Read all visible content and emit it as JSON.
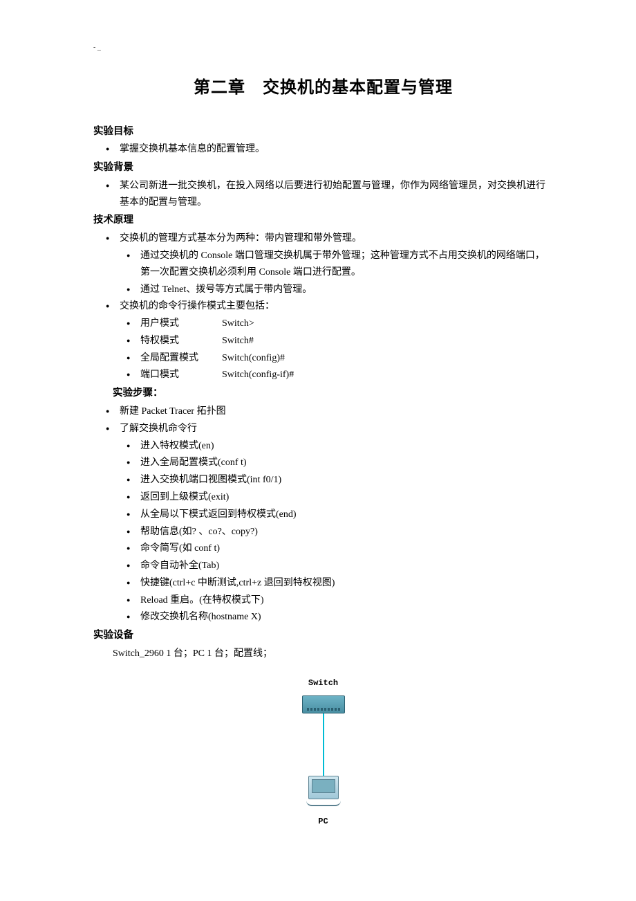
{
  "mark": "- _",
  "title": "第二章　交换机的基本配置与管理",
  "sections": {
    "goal_h": "实验目标",
    "goal_item": "掌握交换机基本信息的配置管理。",
    "bg_h": "实验背景",
    "bg_item": "某公司新进一批交换机，在投入网络以后要进行初始配置与管理，你作为网络管理员，对交换机进行基本的配置与管理。",
    "tech_h": "技术原理",
    "tech_sw_mgmt": "交换机的管理方式基本分为两种：带内管理和带外管理。",
    "tech_console": "通过交换机的 Console 端口管理交换机属于带外管理；这种管理方式不占用交换机的网络端口，第一次配置交换机必须利用 Console 端口进行配置。",
    "tech_telnet": "通过 Telnet、拨号等方式属于带内管理。",
    "tech_modes_h": "交换机的命令行操作模式主要包括：",
    "modes": [
      {
        "label": "用户模式",
        "value": "Switch>"
      },
      {
        "label": "特权模式",
        "value": "Switch#"
      },
      {
        "label": "全局配置模式",
        "value": "Switch(config)#"
      },
      {
        "label": "端口模式",
        "value": "Switch(config-if)#"
      }
    ],
    "steps_h": "实验步骤：",
    "step_topo": "新建 Packet Tracer 拓扑图",
    "step_cli": "了解交换机命令行",
    "cli_items": [
      "进入特权模式(en)",
      "进入全局配置模式(conf t)",
      "进入交换机端口视图模式(int f0/1)",
      "返回到上级模式(exit)",
      "从全局以下模式返回到特权模式(end)",
      "帮助信息(如? 、co?、copy?)",
      "命令简写(如  conf t)",
      "命令自动补全(Tab)",
      "快捷键(ctrl+c 中断测试,ctrl+z 退回到特权视图)",
      "Reload 重启。(在特权模式下)",
      "修改交换机名称(hostname X)"
    ],
    "equip_h": "实验设备",
    "equip_line": "Switch_2960 1 台；PC 1 台；配置线；",
    "diagram": {
      "switch_label": "Switch",
      "pc_label": "PC"
    }
  }
}
